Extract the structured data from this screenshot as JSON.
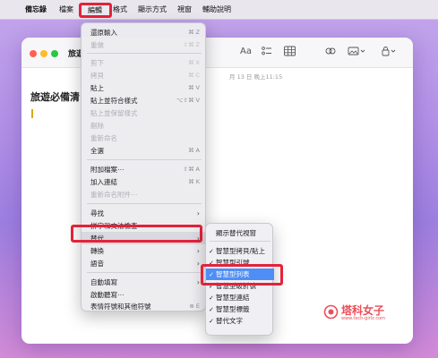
{
  "menubar": {
    "app_name": "備忘錄",
    "items": [
      "檔案",
      "編輯",
      "格式",
      "顯示方式",
      "視窗",
      "輔助說明"
    ]
  },
  "window": {
    "title": "旅遊",
    "date": "月 13 日 晚上11:15",
    "note_heading": "旅遊必備清",
    "toolbar_icons": [
      "format-text-icon",
      "checklist-icon",
      "table-icon",
      "share-people-icon",
      "media-icon",
      "lock-icon"
    ],
    "toolbar_labels": {
      "aa": "Aa"
    }
  },
  "edit_menu": {
    "items": [
      {
        "label": "還原輸入",
        "shortcut": "⌘ Z",
        "enabled": true
      },
      {
        "label": "重做",
        "shortcut": "⇧⌘ Z",
        "enabled": false
      },
      {
        "label": "剪下",
        "shortcut": "⌘ X",
        "enabled": false
      },
      {
        "label": "拷貝",
        "shortcut": "⌘ C",
        "enabled": false
      },
      {
        "label": "貼上",
        "shortcut": "⌘ V",
        "enabled": true
      },
      {
        "label": "貼上並符合樣式",
        "shortcut": "⌥⇧⌘ V",
        "enabled": true
      },
      {
        "label": "貼上並保留樣式",
        "shortcut": "",
        "enabled": false
      },
      {
        "label": "刪除",
        "shortcut": "",
        "enabled": false
      },
      {
        "label": "重新命名",
        "shortcut": "",
        "enabled": false
      },
      {
        "label": "全選",
        "shortcut": "⌘ A",
        "enabled": true
      },
      {
        "label": "附加檔案⋯",
        "shortcut": "⇧⌘ A",
        "enabled": true
      },
      {
        "label": "加入連結",
        "shortcut": "⌘ K",
        "enabled": true
      },
      {
        "label": "重新命名附件⋯",
        "shortcut": "",
        "enabled": false
      },
      {
        "label": "尋找",
        "shortcut": "",
        "enabled": true,
        "submenu": true
      },
      {
        "label": "拼字和文法檢查",
        "shortcut": "",
        "enabled": true,
        "submenu": true
      },
      {
        "label": "替代",
        "shortcut": "",
        "enabled": true,
        "submenu": true
      },
      {
        "label": "轉換",
        "shortcut": "",
        "enabled": true,
        "submenu": true
      },
      {
        "label": "語音",
        "shortcut": "",
        "enabled": true,
        "submenu": true
      },
      {
        "label": "自動填寫",
        "shortcut": "",
        "enabled": true,
        "submenu": true
      },
      {
        "label": "啟動聽寫⋯",
        "shortcut": "",
        "enabled": true
      },
      {
        "label": "表情符號和其他符號",
        "shortcut": "",
        "enabled": true
      }
    ]
  },
  "substitutions_menu": {
    "items": [
      {
        "label": "顯示替代視窗",
        "checked": false
      },
      {
        "label": "智慧型拷貝/貼上",
        "checked": true
      },
      {
        "label": "智慧型引號",
        "checked": true
      },
      {
        "label": "智慧型列表",
        "checked": true,
        "selected": true
      },
      {
        "label": "智慧型破折號",
        "checked": true
      },
      {
        "label": "智慧型連結",
        "checked": true
      },
      {
        "label": "智慧型標籤",
        "checked": true
      },
      {
        "label": "替代文字",
        "checked": true
      }
    ]
  },
  "watermark": {
    "text": "塔科女子",
    "url": "www.tech-girlz.com"
  },
  "colors": {
    "highlight_border": "#e4223a",
    "selection_blue": "#4f8ef5",
    "watermark": "#ea4f5a"
  }
}
